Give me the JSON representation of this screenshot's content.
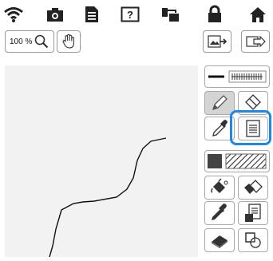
{
  "toolbar": {
    "zoom_label": "100 %",
    "top_icons": [
      "wifi-icon",
      "camera-icon",
      "document-icon",
      "help-icon",
      "design-transfer-icon",
      "lock-icon",
      "home-icon"
    ]
  },
  "side_panel": {
    "buttons": [
      "line-type-button",
      "pencil-button",
      "eraser-button",
      "eyedropper-button",
      "line-properties-button",
      "fill-color-button",
      "fill-pattern-button",
      "bucket-fill-button",
      "region-fill-button",
      "dropper-fill-button",
      "fill-properties-button",
      "delete-button",
      "select-region-button"
    ]
  },
  "highlight": {
    "target": "line-properties-button",
    "color": "#1e88e5"
  },
  "drawing_line_color": "#111111"
}
